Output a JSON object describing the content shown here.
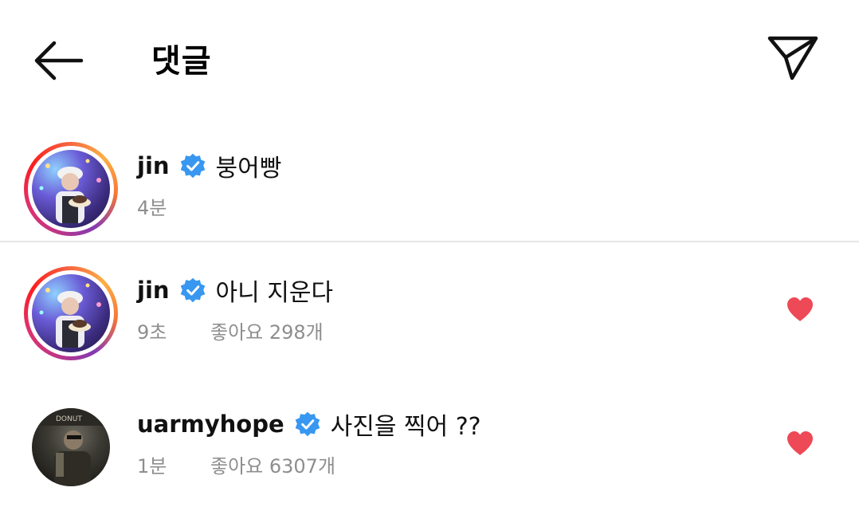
{
  "header": {
    "title": "댓글",
    "back_icon": "arrow-left-icon",
    "send_icon": "paper-plane-icon"
  },
  "comments": [
    {
      "username": "jin",
      "verified": true,
      "text": "붕어빵",
      "time": "4분",
      "likes": "",
      "liked": false
    },
    {
      "username": "jin",
      "verified": true,
      "text": "아니 지운다",
      "time": "9초",
      "likes": "좋아요 298개",
      "liked": true
    },
    {
      "username": "uarmyhope",
      "verified": true,
      "text": "사진을 찍어 ??",
      "time": "1분",
      "likes": "좋아요 6307개",
      "liked": true
    }
  ],
  "colors": {
    "verified_blue": "#3897f0",
    "heart_red": "#ed4956",
    "meta_gray": "#8e8e8e",
    "divider": "#e6e6e6"
  }
}
